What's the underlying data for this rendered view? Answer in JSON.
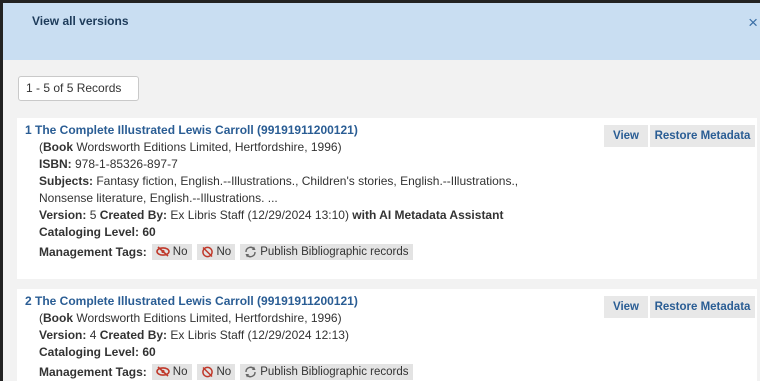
{
  "header": {
    "title": "View all versions",
    "close_icon": "close-icon"
  },
  "records_count": "1 - 5 of 5 Records",
  "records": [
    {
      "title": "1 The Complete Illustrated Lewis Carroll (99191911200121)",
      "book_prefix": "(",
      "book_type": "Book",
      "book_rest": " Wordsworth Editions Limited, Hertfordshire, 1996)",
      "isbn_label": "ISBN:",
      "isbn_value": " 978-1-85326-897-7",
      "subjects_label": "Subjects:",
      "subjects_value": " Fantasy fiction, English.--Illustrations., Children's stories, English.--Illustrations.,",
      "subjects_cont": "Nonsense literature, English.--Illustrations. ...",
      "version_label": "Version:",
      "version_value": " 5 ",
      "created_label": "Created By:",
      "created_value": " Ex Libris Staff (12/29/2024 13:10) ",
      "with_ai": "with AI Metadata Assistant",
      "cataloging_label": "Cataloging Level:",
      "cataloging_value": " 60",
      "tags_label": "Management Tags:",
      "tag1": "No",
      "tag2": "No",
      "tag3": "Publish Bibliographic records",
      "view_label": "View",
      "restore_label": "Restore Metadata"
    },
    {
      "title": "2 The Complete Illustrated Lewis Carroll (99191911200121)",
      "book_prefix": "(",
      "book_type": "Book",
      "book_rest": " Wordsworth Editions Limited, Hertfordshire, 1996)",
      "version_label": "Version:",
      "version_value": " 4 ",
      "created_label": "Created By:",
      "created_value": " Ex Libris Staff (12/29/2024 12:13)",
      "cataloging_label": "Cataloging Level:",
      "cataloging_value": " 60",
      "tags_label": "Management Tags:",
      "tag1": "No",
      "tag2": "No",
      "tag3": "Publish Bibliographic records",
      "view_label": "View",
      "restore_label": "Restore Metadata"
    }
  ],
  "colors": {
    "header_bg": "#c9def2",
    "link": "#2a5d94",
    "tag_bg": "#e3e3e3",
    "icon_red": "#c0392b"
  }
}
